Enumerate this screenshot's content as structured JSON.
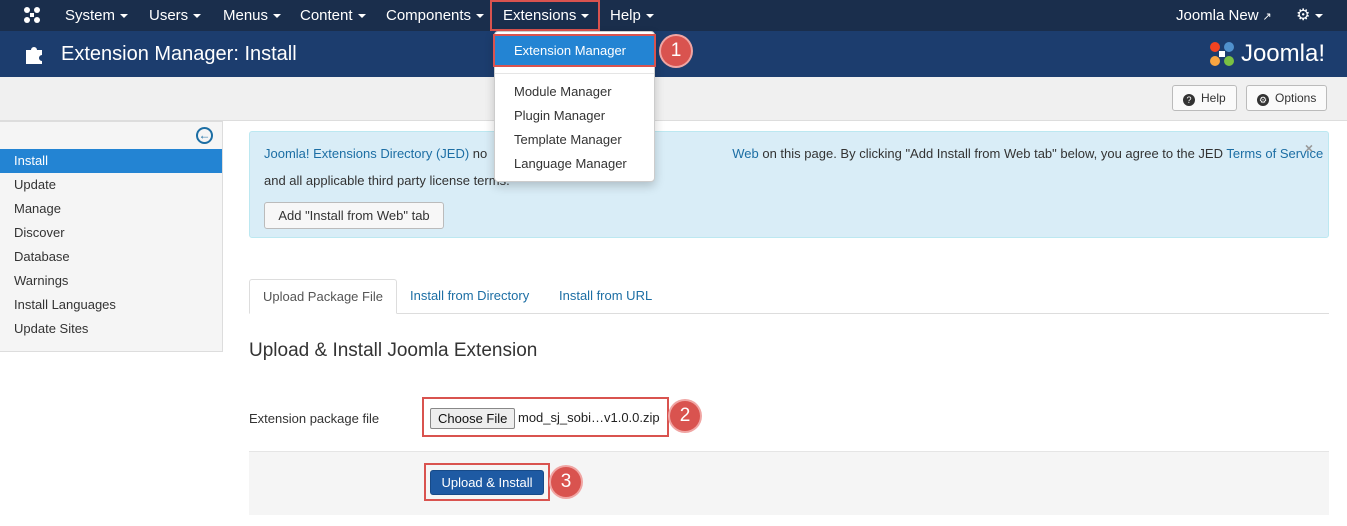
{
  "navbar": {
    "menus": [
      "System",
      "Users",
      "Menus",
      "Content",
      "Components",
      "Extensions",
      "Help"
    ],
    "site_link": "Joomla New"
  },
  "header": {
    "title": "Extension Manager: Install",
    "brand": "Joomla!"
  },
  "toolbar": {
    "help_label": "Help",
    "options_label": "Options"
  },
  "sidebar": {
    "items": [
      "Install",
      "Update",
      "Manage",
      "Discover",
      "Database",
      "Warnings",
      "Install Languages",
      "Update Sites"
    ]
  },
  "dropdown": {
    "items": [
      "Extension Manager",
      "Module Manager",
      "Plugin Manager",
      "Template Manager",
      "Language Manager"
    ]
  },
  "alert": {
    "link1": "Joomla! Extensions Directory (JED)",
    "text1a": " no",
    "link2": "Web",
    "text1b": " on this page.  By clicking \"Add Install from Web tab\" below, you agree to the JED ",
    "link3": "Terms of Service",
    "text2": "and all applicable third party license terms.",
    "button_label": "Add \"Install from Web\" tab",
    "close": "×"
  },
  "tabs": [
    "Upload Package File",
    "Install from Directory",
    "Install from URL"
  ],
  "main": {
    "section_title": "Upload & Install Joomla Extension",
    "field_label": "Extension package file",
    "choose_file_label": "Choose File",
    "file_name": "mod_sj_sobi…v1.0.0.zip",
    "submit_label": "Upload & Install"
  },
  "badges": [
    "1",
    "2",
    "3"
  ],
  "colors": {
    "navbar": "#1a2e4c",
    "header": "#1c3d6e",
    "accent": "#2384d3",
    "badge": "#d9534f",
    "primary": "#1e5aa3"
  }
}
